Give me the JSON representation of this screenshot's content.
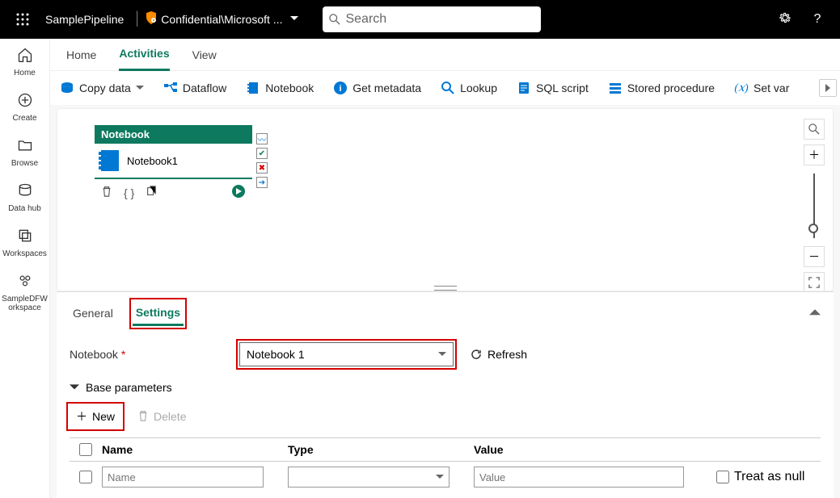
{
  "topbar": {
    "pipeline_name": "SamplePipeline",
    "workspace_name": "Confidential\\Microsoft ...",
    "search_placeholder": "Search"
  },
  "leftrail": {
    "items": [
      {
        "label": "Home"
      },
      {
        "label": "Create"
      },
      {
        "label": "Browse"
      },
      {
        "label": "Data hub"
      },
      {
        "label": "Workspaces"
      },
      {
        "label": "SampleDFW\norkspace"
      }
    ]
  },
  "main_tabs": {
    "home": "Home",
    "activities": "Activities",
    "view": "View"
  },
  "ribbon": {
    "copy_data": "Copy data",
    "dataflow": "Dataflow",
    "notebook": "Notebook",
    "get_metadata": "Get metadata",
    "lookup": "Lookup",
    "sql_script": "SQL script",
    "stored_procedure": "Stored procedure",
    "set_var": "Set var"
  },
  "canvas": {
    "activity_type": "Notebook",
    "activity_name": "Notebook1"
  },
  "config": {
    "tabs": {
      "general": "General",
      "settings": "Settings"
    },
    "notebook_label": "Notebook",
    "notebook_selected": "Notebook 1",
    "refresh": "Refresh",
    "base_params": "Base parameters",
    "new_btn": "New",
    "delete_btn": "Delete",
    "headers": {
      "name": "Name",
      "type": "Type",
      "value": "Value"
    },
    "row": {
      "name_placeholder": "Name",
      "value_placeholder": "Value",
      "treat_null": "Treat as null"
    }
  }
}
